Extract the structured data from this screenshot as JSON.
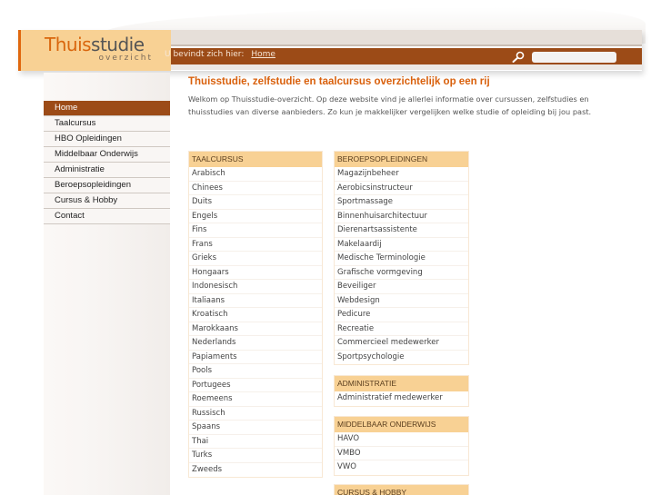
{
  "logo": {
    "part1": "Thuis",
    "part2": "studie",
    "sub": "overzicht"
  },
  "breadcrumb": {
    "label": "U bevindt zich hier:",
    "link": "Home"
  },
  "search": {
    "placeholder": "",
    "value": ""
  },
  "sidebar": {
    "items": [
      {
        "label": "Home",
        "active": true
      },
      {
        "label": "Taalcursus"
      },
      {
        "label": "HBO Opleidingen"
      },
      {
        "label": "Middelbaar Onderwijs"
      },
      {
        "label": "Administratie"
      },
      {
        "label": "Beroepsopleidingen"
      },
      {
        "label": "Cursus & Hobby"
      },
      {
        "label": "Contact"
      }
    ]
  },
  "main": {
    "title": "Thuisstudie, zelfstudie en taalcursus overzichtelijk op een rij",
    "intro": "Welkom op Thuisstudie-overzicht. Op deze website vind je allerlei informatie over cursussen, zelfstudies en thuisstudies van diverse aanbieders. Zo kun je makkelijker vergelijken welke studie of opleiding bij jou past."
  },
  "tables": {
    "taalcursus": {
      "header": "TAALCURSUS",
      "items": [
        "Arabisch",
        "Chinees",
        "Duits",
        "Engels",
        "Fins",
        "Frans",
        "Grieks",
        "Hongaars",
        "Indonesisch",
        "Italiaans",
        "Kroatisch",
        "Marokkaans",
        "Nederlands",
        "Papiaments",
        "Pools",
        "Portugees",
        "Roemeens",
        "Russisch",
        "Spaans",
        "Thai",
        "Turks",
        "Zweeds"
      ]
    },
    "beroeps": {
      "header": "BEROEPSOPLEIDINGEN",
      "items": [
        "Magazijnbeheer",
        "Aerobicsinstructeur",
        "Sportmassage",
        "Binnenhuisarchitectuur",
        "Dierenartsassistente",
        "Makelaardij",
        "Medische Terminologie",
        "Grafische vormgeving",
        "Beveiliger",
        "Webdesign",
        "Pedicure",
        "Recreatie",
        "Commercieel medewerker",
        "Sportpsychologie"
      ]
    },
    "administratie": {
      "header": "ADMINISTRATIE",
      "items": [
        "Administratief medewerker"
      ]
    },
    "middelbaar": {
      "header": "MIDDELBAAR ONDERWIJS",
      "items": [
        "HAVO",
        "VMBO",
        "VWO"
      ]
    },
    "hobby": {
      "header": "CURSUS & HOBBY",
      "items": []
    }
  },
  "colors": {
    "brand_orange": "#d9600c",
    "brand_brown": "#9c4b17",
    "header_tan": "#f8d194"
  }
}
